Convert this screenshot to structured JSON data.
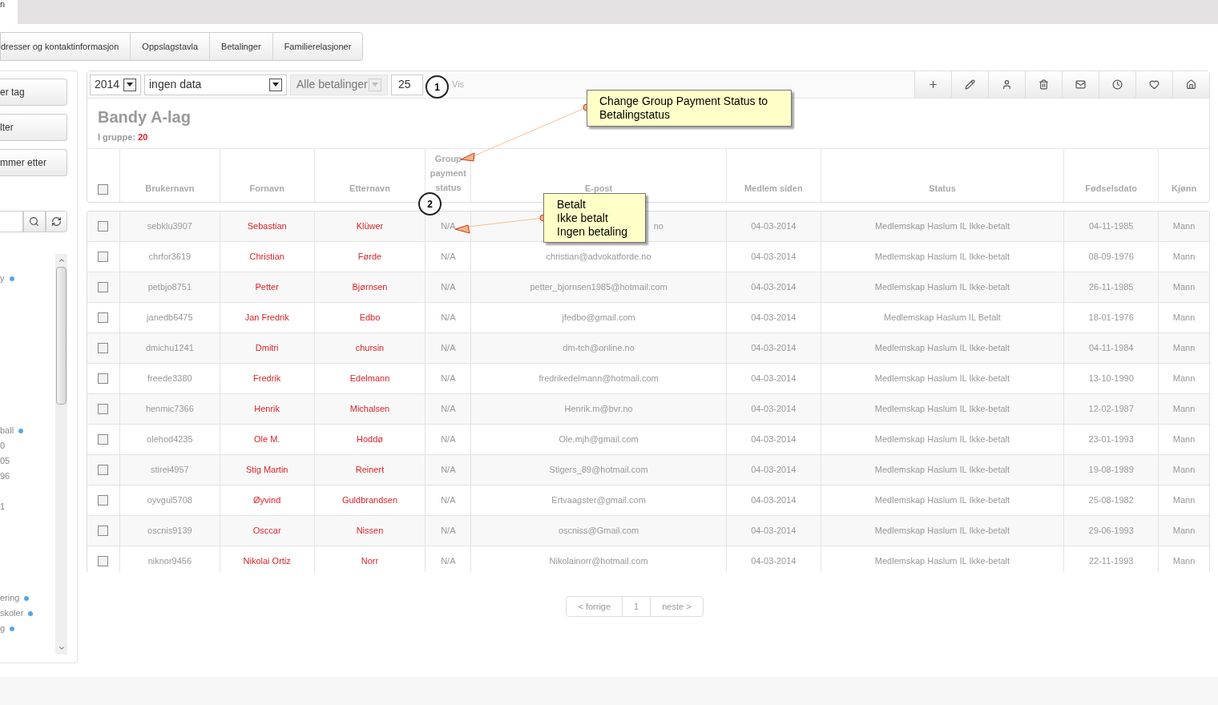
{
  "top_tab": {
    "label": "n"
  },
  "tabs": [
    {
      "label": "dresser og kontaktinformasjon"
    },
    {
      "label": "Oppslagstavla"
    },
    {
      "label": "Betalinger"
    },
    {
      "label": "Familierelasjoner"
    }
  ],
  "sidebar": {
    "buttons": [
      "er tag",
      "lter",
      "mmer etter"
    ],
    "groups": [
      [
        {
          "label": "y",
          "dot": true
        }
      ],
      [
        {
          "label": "ball",
          "dot": true
        },
        {
          "label": "0",
          "dot": false
        },
        {
          "label": "05",
          "dot": false
        },
        {
          "label": "96",
          "dot": false
        }
      ],
      [
        {
          "label": "1",
          "dot": false
        }
      ],
      [
        {
          "label": "ering",
          "dot": true
        },
        {
          "label": "skoler",
          "dot": true
        },
        {
          "label": "g",
          "dot": true
        }
      ]
    ]
  },
  "filters": {
    "year": "2014",
    "data": "ingen data",
    "payments": {
      "value": "Alle betalinger",
      "disabled": true
    },
    "per_page": "25",
    "show_label": "Vis"
  },
  "group": {
    "title": "Bandy A-lag",
    "count_label": "I gruppe:",
    "count": "20"
  },
  "table": {
    "select_all": {
      "checked": false
    },
    "columns": [
      "Brukernavn",
      "Fornavn",
      "Etternavn",
      "Group payment status",
      "E-post",
      "Medlem siden",
      "Status",
      "Fødselsdato",
      "Kjønn"
    ],
    "rows": [
      {
        "checked": false,
        "cells": [
          "sebklu3907",
          "Sebastian",
          "Klüwer",
          "N/A",
          "no",
          "04-03-2014",
          "Medlemskap Haslum IL Ikke-betalt",
          "04-11-1985",
          "Mann"
        ]
      },
      {
        "checked": false,
        "cells": [
          "chrfor3619",
          "Christian",
          "Førde",
          "N/A",
          "christian@advokatforde.no",
          "04-03-2014",
          "Medlemskap Haslum IL Ikke-betalt",
          "08-09-1976",
          "Mann"
        ]
      },
      {
        "checked": false,
        "cells": [
          "petbjo8751",
          "Petter",
          "Bjørnsen",
          "N/A",
          "petter_bjornsen1985@hotmail.com",
          "04-03-2014",
          "Medlemskap Haslum IL Ikke-betalt",
          "26-11-1985",
          "Mann"
        ]
      },
      {
        "checked": false,
        "cells": [
          "janedb6475",
          "Jan Fredrik",
          "Edbo",
          "N/A",
          "jfedbo@gmail.com",
          "04-03-2014",
          "Medlemskap Haslum IL Betalt",
          "18-01-1976",
          "Mann"
        ]
      },
      {
        "checked": false,
        "cells": [
          "dmichu1241",
          "Dmitri",
          "chursin",
          "N/A",
          "dm-tch@online.no",
          "04-03-2014",
          "Medlemskap Haslum IL Ikke-betalt",
          "04-11-1984",
          "Mann"
        ]
      },
      {
        "checked": false,
        "cells": [
          "freede3380",
          "Fredrik",
          "Edelmann",
          "N/A",
          "fredrikedelmann@hotmail.com",
          "04-03-2014",
          "Medlemskap Haslum IL Ikke-betalt",
          "13-10-1990",
          "Mann"
        ]
      },
      {
        "checked": false,
        "cells": [
          "henmic7366",
          "Henrik",
          "Michalsen",
          "N/A",
          "Henrik.m@bvr.no",
          "04-03-2014",
          "Medlemskap Haslum IL Ikke-betalt",
          "12-02-1987",
          "Mann"
        ]
      },
      {
        "checked": false,
        "cells": [
          "olehod4235",
          "Ole M.",
          "Hoddø",
          "N/A",
          "Ole.mjh@gmail.com",
          "04-03-2014",
          "Medlemskap Haslum IL Ikke-betalt",
          "23-01-1993",
          "Mann"
        ]
      },
      {
        "checked": false,
        "cells": [
          "stirei4957",
          "Stig Martin",
          "Reinert",
          "N/A",
          "Stigers_89@hotmail.com",
          "04-03-2014",
          "Medlemskap Haslum IL Ikke-betalt",
          "19-08-1989",
          "Mann"
        ]
      },
      {
        "checked": false,
        "cells": [
          "oyvgul5708",
          "Øyvind",
          "Guldbrandsen",
          "N/A",
          "Ertvaagster@gmail.com",
          "04-03-2014",
          "Medlemskap Haslum IL Ikke-betalt",
          "25-08-1982",
          "Mann"
        ]
      },
      {
        "checked": false,
        "cells": [
          "oscnis9139",
          "Osccar",
          "Nissen",
          "N/A",
          "oscniss@Gmail.com",
          "04-03-2014",
          "Medlemskap Haslum IL Ikke-betalt",
          "29-06-1993",
          "Mann"
        ]
      },
      {
        "checked": false,
        "cells": [
          "niknor9456",
          "Nikolai Ortiz",
          "Norr",
          "N/A",
          "Nikolainorr@hotmail.com",
          "04-03-2014",
          "Medlemskap Haslum IL Ikke-betalt",
          "22-11-1993",
          "Mann"
        ]
      }
    ]
  },
  "pagination": [
    "< forrige",
    "1",
    "neste >"
  ],
  "annotations": [
    {
      "number": "1",
      "text": "Change Group Payment Status to Betalingstatus"
    },
    {
      "number": "2",
      "lines": [
        "Betalt",
        "Ikke betalt",
        "Ingen betaling"
      ]
    }
  ]
}
